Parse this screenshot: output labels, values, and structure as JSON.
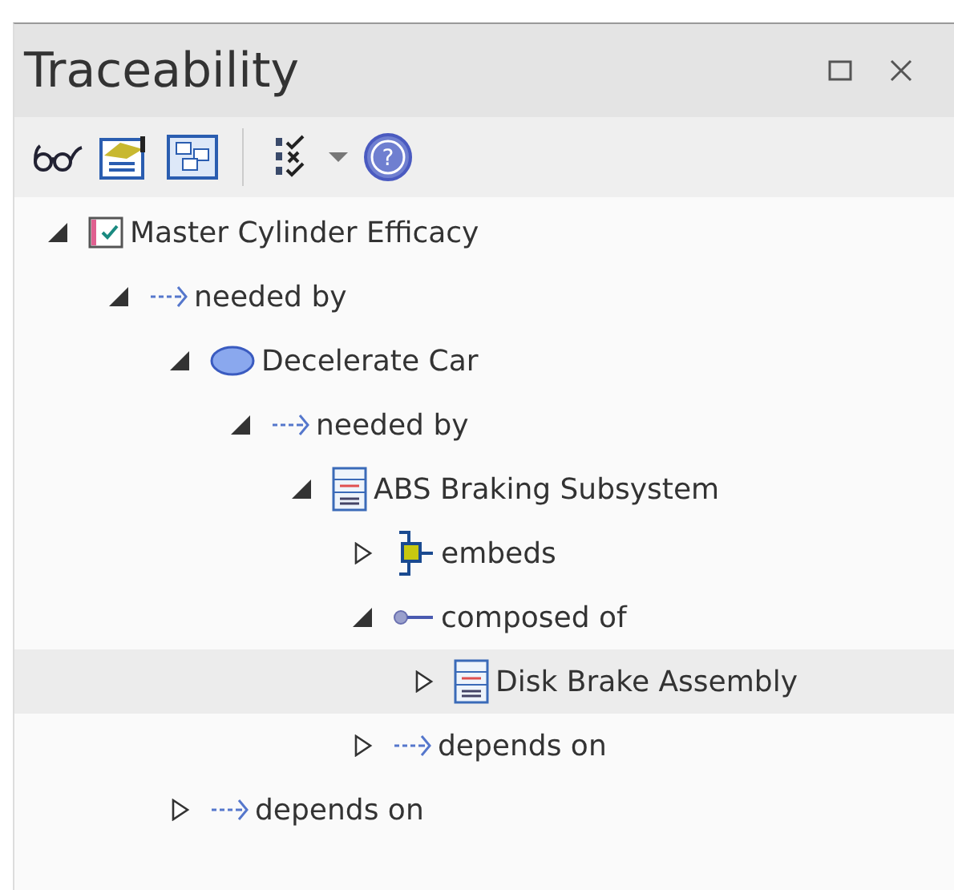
{
  "panel": {
    "title": "Traceability"
  },
  "toolbar": [
    {
      "kind": "glasses"
    },
    {
      "kind": "properties"
    },
    {
      "kind": "diagram"
    },
    {
      "kind": "separator"
    },
    {
      "kind": "checklist"
    },
    {
      "kind": "dropdown"
    },
    {
      "kind": "help",
      "glyph": "?"
    }
  ],
  "tree": [
    {
      "kind": "requirement",
      "label": "Master Cylinder Efficacy",
      "expanded": true,
      "selected": false,
      "children": [
        {
          "kind": "dependency",
          "label": "needed by",
          "expanded": true,
          "selected": false,
          "children": [
            {
              "kind": "usecase",
              "label": "Decelerate Car",
              "expanded": true,
              "selected": false,
              "children": [
                {
                  "kind": "dependency",
                  "label": "needed by",
                  "expanded": true,
                  "selected": false,
                  "children": [
                    {
                      "kind": "block",
                      "label": "ABS Braking Subsystem",
                      "expanded": true,
                      "selected": false,
                      "children": [
                        {
                          "kind": "embeds",
                          "label": "embeds",
                          "expanded": false,
                          "selected": false
                        },
                        {
                          "kind": "composition",
                          "label": "composed of",
                          "expanded": true,
                          "selected": false,
                          "children": [
                            {
                              "kind": "block",
                              "label": "Disk Brake Assembly",
                              "expanded": false,
                              "selected": true
                            }
                          ]
                        },
                        {
                          "kind": "dependency",
                          "label": "depends on",
                          "expanded": false,
                          "selected": false
                        }
                      ]
                    }
                  ]
                }
              ]
            },
            {
              "kind": "dependency",
              "label": "depends on",
              "expanded": false,
              "selected": false
            }
          ]
        }
      ]
    }
  ]
}
